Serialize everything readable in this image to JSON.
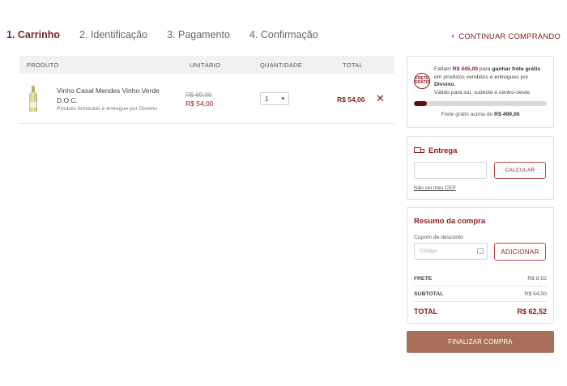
{
  "steps": [
    {
      "label": "1. Carrinho"
    },
    {
      "label": "2. Identificação"
    },
    {
      "label": "3. Pagamento"
    },
    {
      "label": "4. Confirmação"
    }
  ],
  "continue_label": "CONTINUAR COMPRANDO",
  "table": {
    "headers": {
      "product": "PRODUTO",
      "unit": "UNITÁRIO",
      "qty": "QUANTIDADE",
      "total": "TOTAL"
    }
  },
  "item": {
    "name": "Vinho Casal Mendes Vinho Verde D.O.C.",
    "seller": "Produto fornecido e entregue por Divvino",
    "old_price": "R$ 69,90",
    "price": "R$ 54,00",
    "quantity": "1",
    "total": "R$ 54,00",
    "remove_icon": "close-icon"
  },
  "shipping": {
    "badge": "FRETE GRÁTIS",
    "prefix": "Faltam ",
    "amount": "R$ 445,00",
    "mid": " para ",
    "highlight": "ganhar frete grátis",
    "suffix": " em produtos vendidos e entregues por ",
    "store": "Divvino.",
    "region": "Válido para sul, sudeste e centro-oeste.",
    "progress_pct": 10,
    "footer_prefix": "Frete grátis acima de ",
    "footer_amount": "R$ 499,00"
  },
  "entrega": {
    "title": "Entrega",
    "cep_value": "",
    "calc_label": "CALCULAR",
    "link": "Não sei meu CEP"
  },
  "resumo": {
    "title": "Resumo da compra",
    "coupon_label": "Cupom de desconto",
    "coupon_placeholder": "Código",
    "add_label": "ADICIONAR",
    "frete_label": "FRETE",
    "frete_value": "R$ 8,52",
    "subtotal_label": "SUBTOTAL",
    "subtotal_value": "R$ 54,00",
    "total_label": "TOTAL",
    "total_value": "R$ 62,52"
  },
  "finalize_label": "FINALIZAR COMPRA",
  "colors": {
    "accent": "#8b1a1a",
    "button": "#a8705a",
    "progress": "#5a0f14"
  }
}
